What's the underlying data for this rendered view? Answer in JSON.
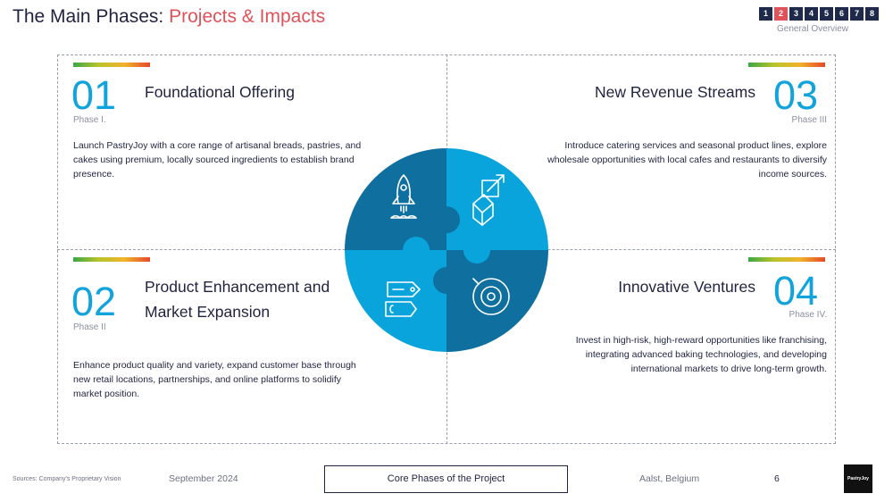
{
  "header": {
    "title_main": "The Main Phases: ",
    "title_accent": "Projects & Impacts",
    "pages": [
      "1",
      "2",
      "3",
      "4",
      "5",
      "6",
      "7",
      "8"
    ],
    "active_page": "2",
    "overview_label": "General Overview"
  },
  "phases": [
    {
      "number": "01",
      "phase_label": "Phase I.",
      "heading": "Foundational Offering",
      "description": "Launch PastryJoy with a core range of artisanal breads, pastries, and cakes using premium, locally sourced ingredients to establish brand presence."
    },
    {
      "number": "02",
      "phase_label": "Phase II",
      "heading": "Product Enhancement and Market Expansion",
      "description": "Enhance product quality and variety, expand customer base through new retail locations, partnerships, and online platforms to solidify market position."
    },
    {
      "number": "03",
      "phase_label": "Phase III",
      "heading": "New Revenue Streams",
      "description": "Introduce catering services and seasonal product lines, explore wholesale opportunities with local cafes and restaurants to diversify income sources."
    },
    {
      "number": "04",
      "phase_label": "Phase IV.",
      "heading": "Innovative Ventures",
      "description": "Invest in high-risk, high-reward opportunities like franchising, integrating advanced baking technologies, and developing international markets to drive long-term growth."
    }
  ],
  "puzzle": {
    "dark_color": "#0f6f9e",
    "light_color": "#0aa4dd",
    "icons": [
      "rocket-icon",
      "shapes-icon",
      "tags-icon",
      "orbit-icon"
    ]
  },
  "footer": {
    "sources": "Sources: Company's Proprietary Vision",
    "date": "September 2024",
    "center_label": "Core Phases of the Project",
    "location": "Aalst, Belgium",
    "page_number": "6",
    "logo_text": "PastryJoy"
  }
}
